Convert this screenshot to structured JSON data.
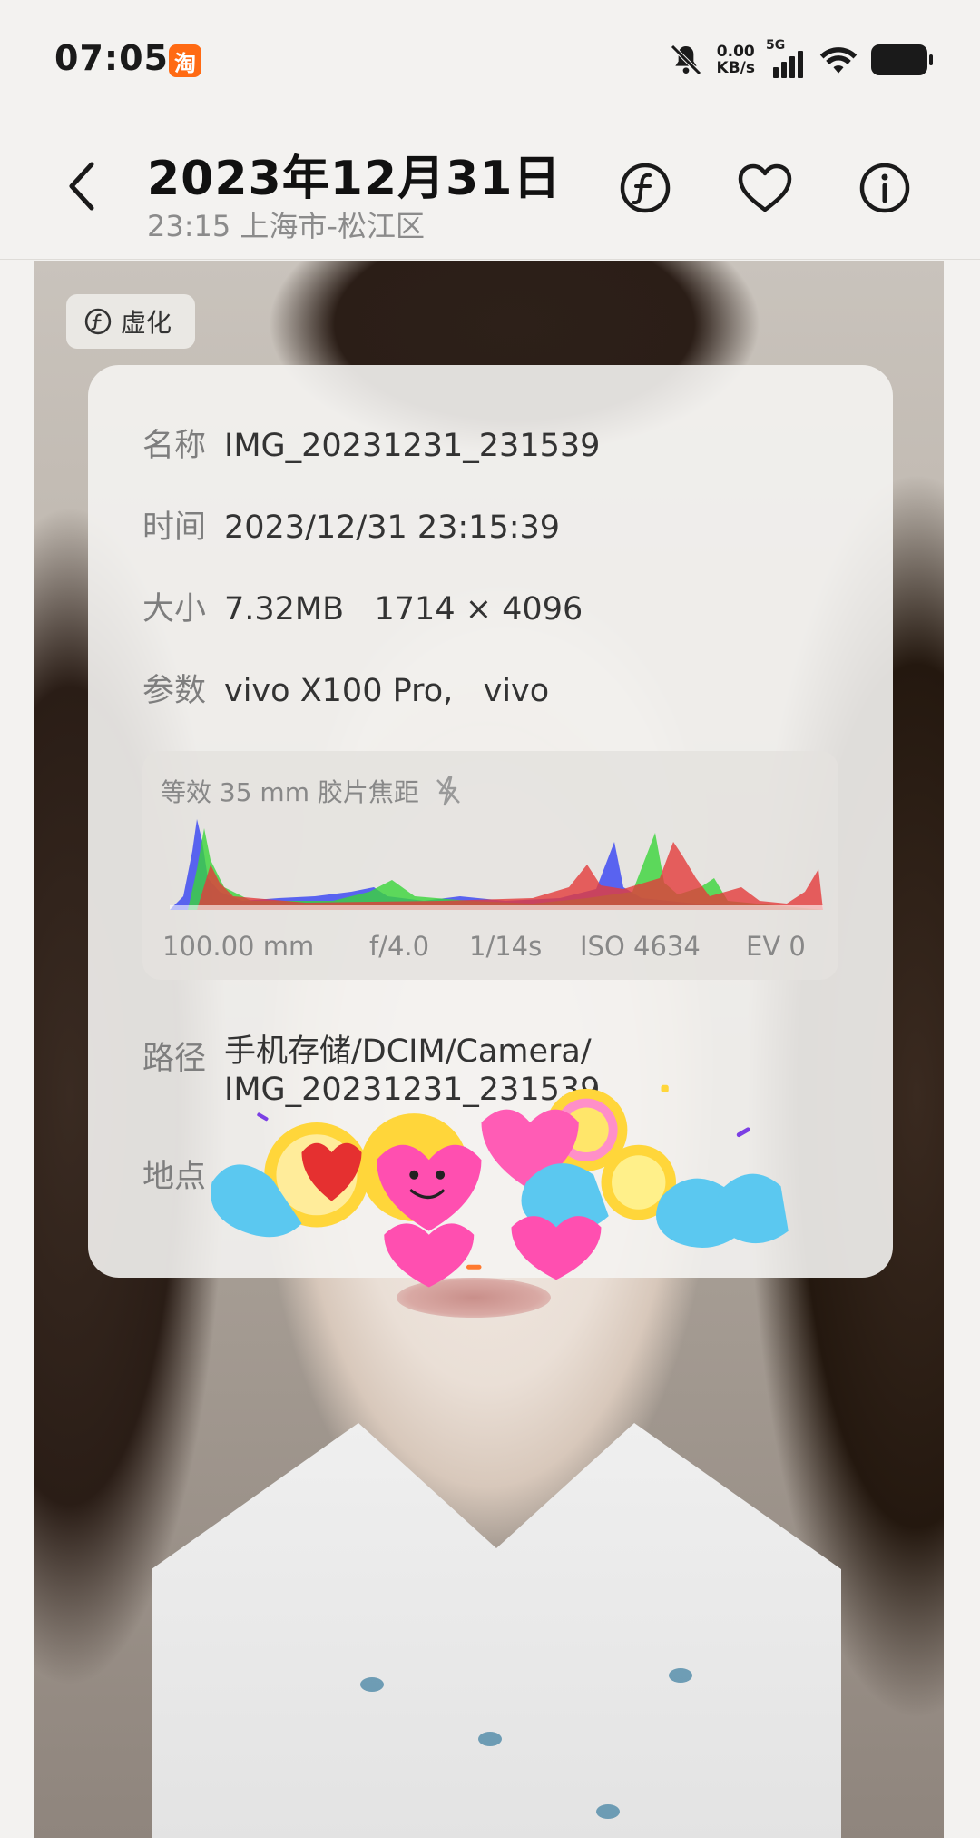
{
  "status_bar": {
    "time": "07:05",
    "app_badge": "淘",
    "speed_value": "0.00",
    "speed_unit": "KB/s",
    "network": "5G"
  },
  "header": {
    "title": "2023年12月31日",
    "subtitle": "23:15 上海市-松江区"
  },
  "photo": {
    "chip_label": "虚化"
  },
  "info": {
    "name_label": "名称",
    "name_value": "IMG_20231231_231539",
    "time_label": "时间",
    "time_value": "2023/12/31 23:15:39",
    "size_label": "大小",
    "size_value": "7.32MB   1714 × 4096",
    "params_label": "参数",
    "params_value": "vivo X100 Pro,   vivo",
    "exif": {
      "focal_label": "等效 35 mm 胶片焦距",
      "focal": "100.00 mm",
      "aperture": "f/4.0",
      "shutter": "1/14s",
      "iso": "ISO 4634",
      "ev": "EV 0"
    },
    "path_label": "路径",
    "path_line1": "手机存储/DCIM/Camera/",
    "path_line2": "IMG_20231231_231539",
    "location_label": "地点"
  },
  "colors": {
    "accent_orange": "#ff6a13",
    "histogram_blue": "#3f4cf2",
    "histogram_green": "#39d43a",
    "histogram_red": "#e43b3b"
  }
}
